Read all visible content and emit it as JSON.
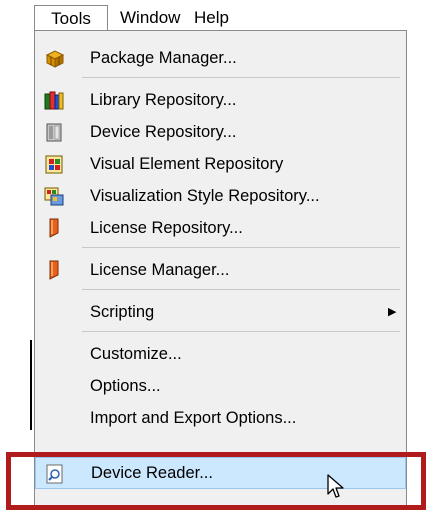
{
  "menubar": {
    "tools": "Tools",
    "window": "Window",
    "help": "Help"
  },
  "menu": {
    "package_manager": "Package Manager...",
    "library_repository": "Library Repository...",
    "device_repository": "Device Repository...",
    "visual_element_repository": "Visual Element Repository",
    "visualization_style_repository": "Visualization Style Repository...",
    "license_repository": "License Repository...",
    "license_manager": "License Manager...",
    "scripting": "Scripting",
    "customize": "Customize...",
    "options": "Options...",
    "import_export_options": "Import and Export Options...",
    "device_reader": "Device Reader..."
  },
  "colors": {
    "highlight_bg": "#cce8ff",
    "highlight_border": "#99c7f0",
    "callout_red": "#b01b1b"
  },
  "icons": {
    "package_manager": "package-icon",
    "library_repository": "library-books-icon",
    "device_repository": "device-icon",
    "visual_element_repository": "visual-element-icon",
    "visualization_style_repository": "visualization-style-icon",
    "license_repository": "license-icon",
    "license_manager": "license-icon",
    "scripting_submenu": "submenu-arrow-icon",
    "device_reader": "device-reader-icon",
    "cursor": "mouse-pointer-icon"
  }
}
